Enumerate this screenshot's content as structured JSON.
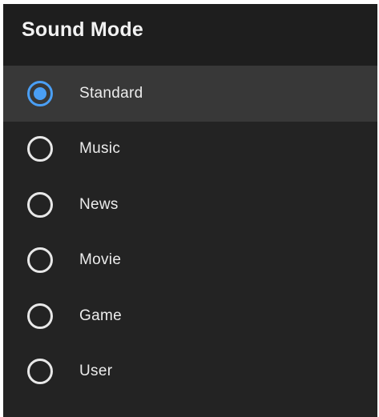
{
  "header": {
    "title": "Sound Mode"
  },
  "options": [
    {
      "label": "Standard",
      "selected": true
    },
    {
      "label": "Music",
      "selected": false
    },
    {
      "label": "News",
      "selected": false
    },
    {
      "label": "Movie",
      "selected": false
    },
    {
      "label": "Game",
      "selected": false
    },
    {
      "label": "User",
      "selected": false
    }
  ],
  "colors": {
    "background": "#232323",
    "header_background": "#1e1e1e",
    "selected_row": "#383838",
    "accent": "#4a9ff5",
    "text": "#ececec"
  }
}
